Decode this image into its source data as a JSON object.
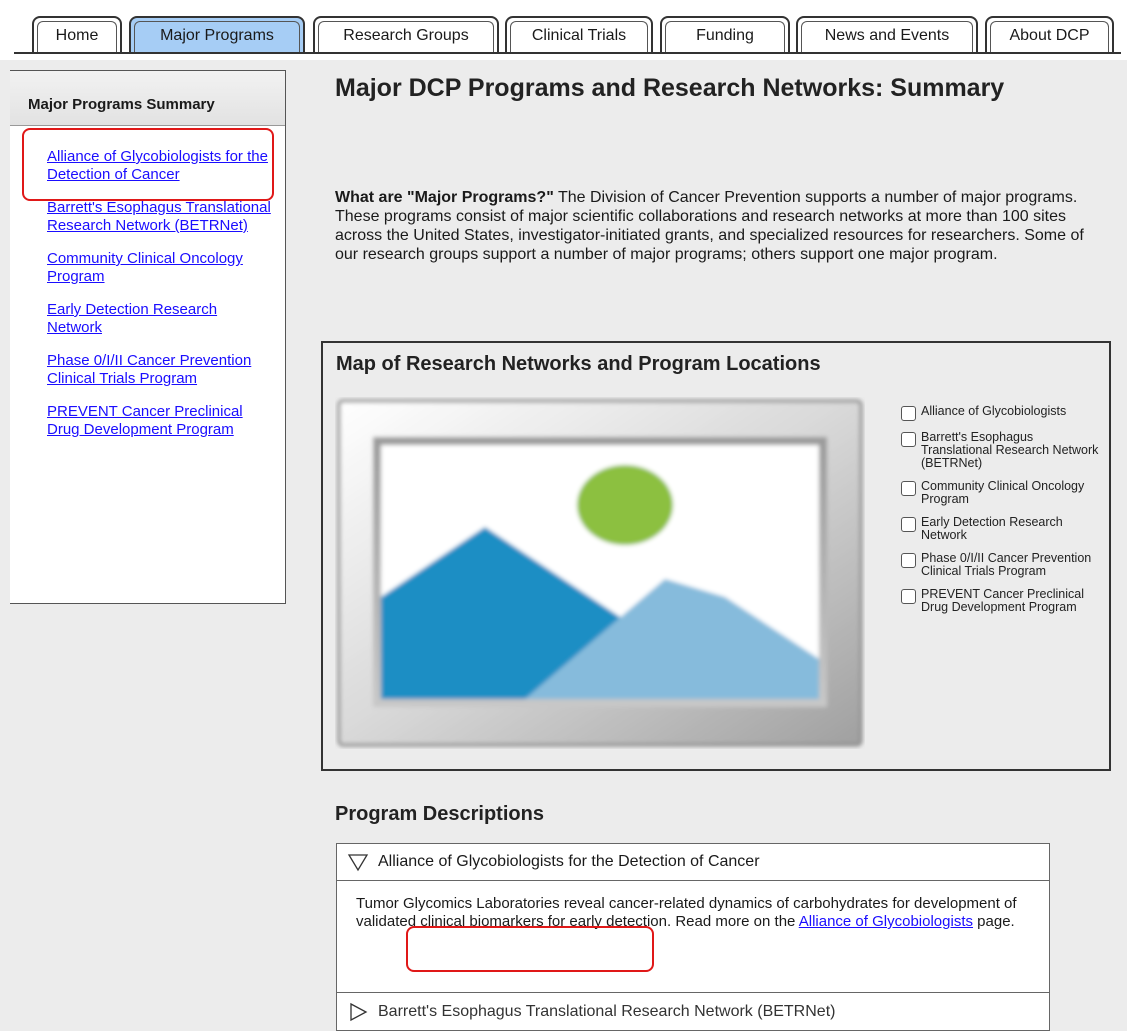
{
  "nav": {
    "tabs": [
      {
        "label": "Home",
        "active": false
      },
      {
        "label": "Major Programs",
        "active": true
      },
      {
        "label": "Research Groups",
        "active": false
      },
      {
        "label": "Clinical Trials",
        "active": false
      },
      {
        "label": "Funding",
        "active": false
      },
      {
        "label": "News and Events",
        "active": false
      },
      {
        "label": "About DCP",
        "active": false
      }
    ],
    "active_color": "#a6cdf5"
  },
  "sidebar": {
    "header": "Major Programs Summary",
    "links": [
      "Alliance of Glycobiologists for the Detection of Cancer",
      "Barrett's Esophagus Translational Research Network (BETRNet)",
      "Community Clinical Oncology Program",
      "Early Detection Research Network",
      "Phase 0/I/II Cancer Prevention Clinical Trials Program",
      "PREVENT Cancer Preclinical Drug Development Program"
    ],
    "link_color": "#1a0dff"
  },
  "main": {
    "title": "Major DCP Programs and Research Networks: Summary",
    "intro_bold": "What are \"Major Programs?\"",
    "intro_text": " The Division of Cancer Prevention supports a number of major programs.  These programs consist of major scientific collaborations and research networks at more than 100 sites across the United States, investigator-initiated grants, and specialized resources for researchers.  Some of our research groups support a number of major programs; others support one major program."
  },
  "map": {
    "title": "Map of Research Networks and Program Locations",
    "image_icon": "image-placeholder-icon",
    "legend": [
      {
        "label": "Alliance of Glycobiologists",
        "checked": false
      },
      {
        "label": "Barrett's Esophagus Translational Research Network (BETRNet)",
        "checked": false
      },
      {
        "label": "Community Clinical Oncology Program",
        "checked": false
      },
      {
        "label": "Early Detection Research Network",
        "checked": false
      },
      {
        "label": "Phase 0/I/II Cancer Prevention Clinical Trials Program",
        "checked": false
      },
      {
        "label": "PREVENT Cancer Preclinical Drug Development Program",
        "checked": false
      }
    ]
  },
  "descriptions": {
    "title": "Program Descriptions",
    "expanded": {
      "header": "Alliance of Glycobiologists for the Detection of Cancer",
      "body_before": "Tumor Glycomics Laboratories reveal cancer-related dynamics of carbohydrates for development of validated clinical biomarkers for early detection.  Read more on the ",
      "link": "Alliance of Glycobiologists",
      "body_after": " page."
    },
    "next_header": "Barrett's Esophagus Translational Research Network (BETRNet)"
  },
  "annotation_color": "#e01818"
}
